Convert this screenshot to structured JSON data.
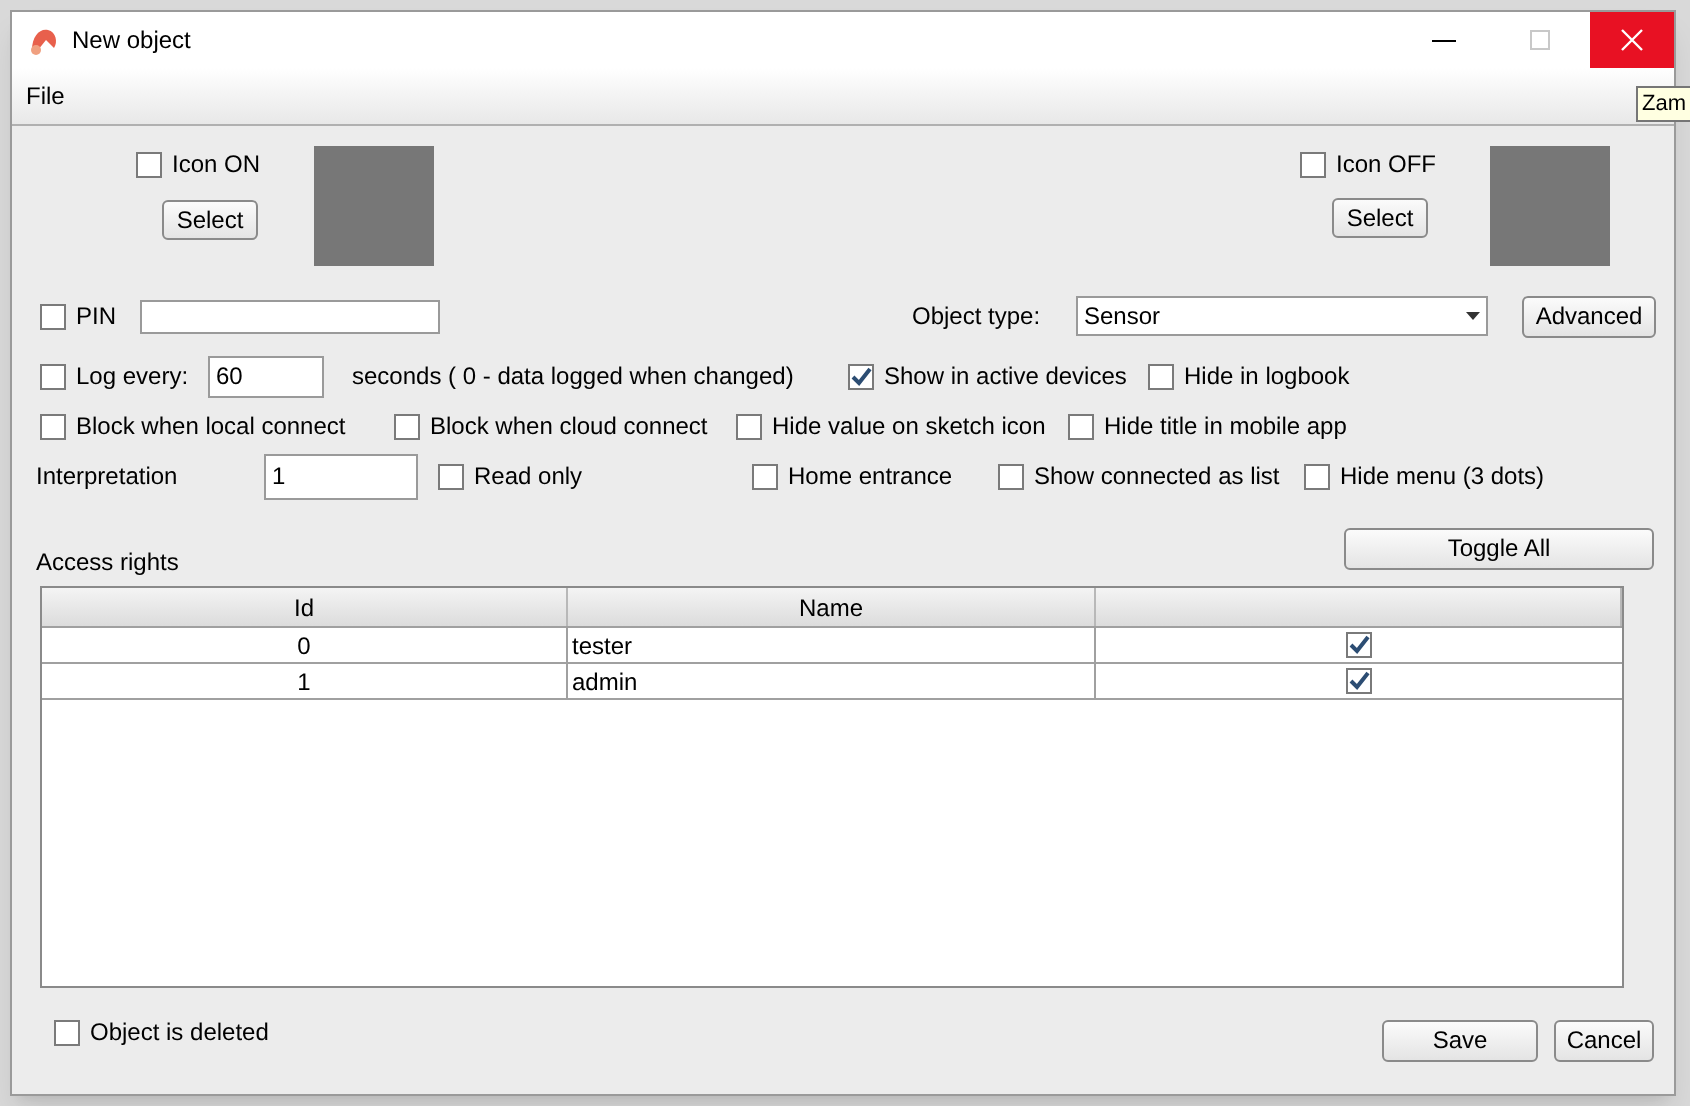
{
  "window": {
    "title": "New object"
  },
  "menu": [
    "File"
  ],
  "tooltip": "Zam",
  "icon_on": {
    "label": "Icon ON",
    "checked": false,
    "button": "Select"
  },
  "icon_off": {
    "label": "Icon OFF",
    "checked": false,
    "button": "Select"
  },
  "pin": {
    "label": "PIN",
    "checked": false
  },
  "object_type": {
    "label": "Object type:",
    "value": "Sensor"
  },
  "advanced_button": "Advanced",
  "log": {
    "label": "Log every:",
    "checked": false,
    "value": "60",
    "note": "seconds ( 0 - data logged when changed)"
  },
  "flags_row1": [
    {
      "label": "Show in active devices",
      "checked": true
    },
    {
      "label": "Hide in logbook",
      "checked": false
    }
  ],
  "flags_row2": [
    {
      "label": "Block when local connect",
      "checked": false
    },
    {
      "label": "Block when cloud connect",
      "checked": false
    },
    {
      "label": "Hide value on sketch icon",
      "checked": false
    },
    {
      "label": "Hide title in mobile app",
      "checked": false
    }
  ],
  "interpretation": {
    "label": "Interpretation",
    "value": "1"
  },
  "flags_row3": [
    {
      "label": "Read only",
      "checked": false
    },
    {
      "label": "Home entrance",
      "checked": false
    },
    {
      "label": "Show connected as list",
      "checked": false
    },
    {
      "label": "Hide menu (3 dots)",
      "checked": false
    }
  ],
  "access_rights": {
    "label": "Access rights",
    "toggle_button": "Toggle All",
    "columns": [
      "Id",
      "Name"
    ],
    "rows": [
      {
        "id": "0",
        "name": "tester",
        "checked": true
      },
      {
        "id": "1",
        "name": "admin",
        "checked": true
      }
    ]
  },
  "object_deleted": {
    "label": "Object is deleted",
    "checked": false
  },
  "buttons": [
    "Save",
    "Cancel"
  ]
}
